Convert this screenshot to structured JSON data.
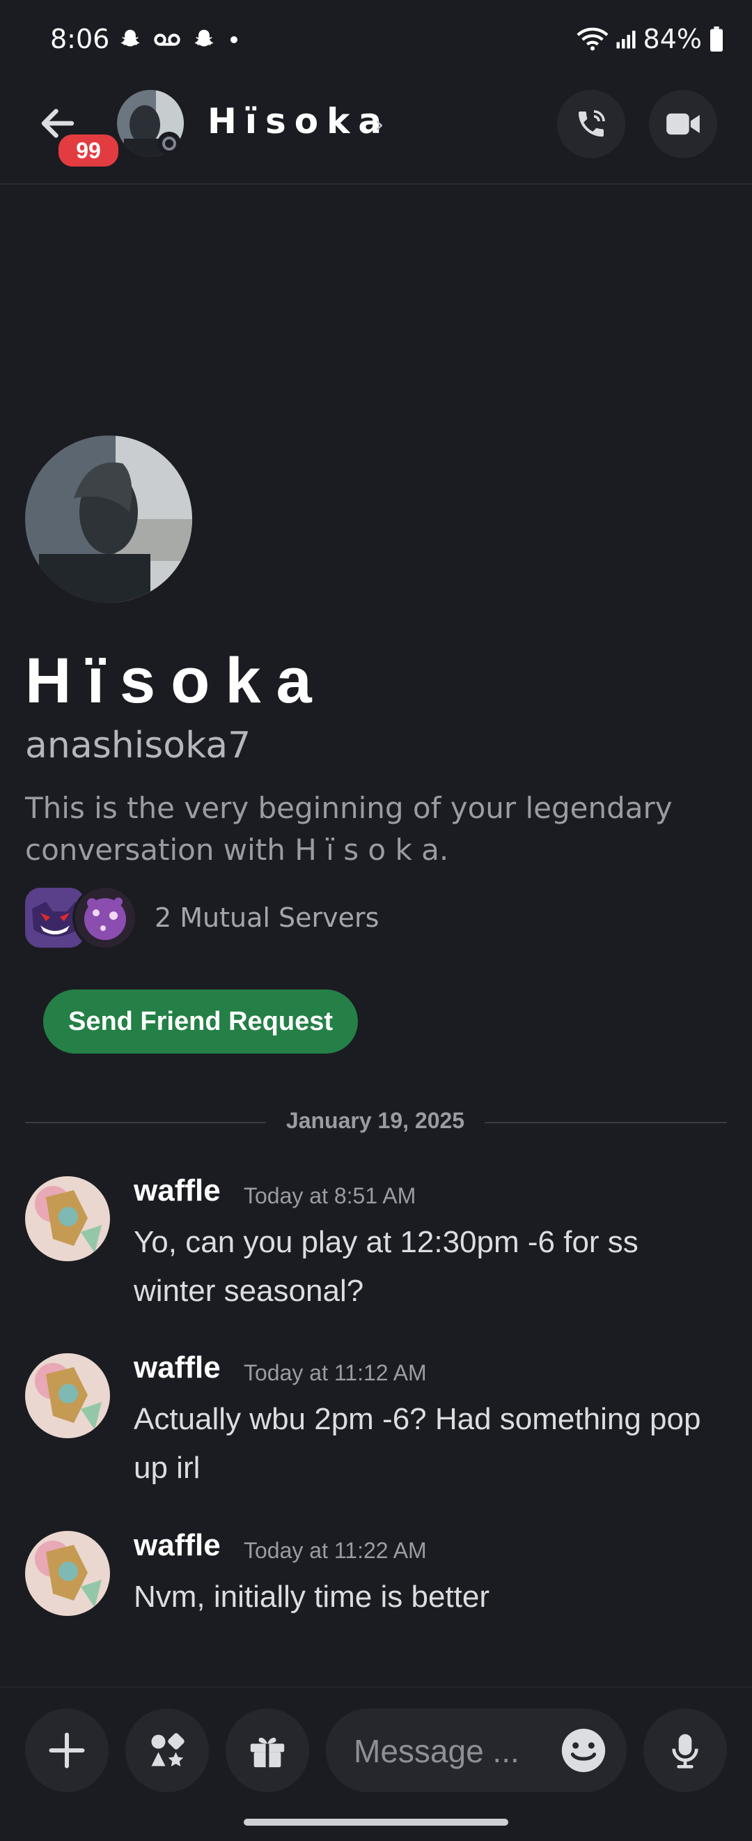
{
  "status_bar": {
    "time": "8:06",
    "battery": "84%",
    "icons": [
      "snapchat-icon",
      "voicemail-icon",
      "snapchat-icon",
      "dot-icon",
      "wifi-icon",
      "signal-icon",
      "battery-icon"
    ]
  },
  "header": {
    "name": "Hïsoka",
    "chevron": "›",
    "badge": "99"
  },
  "profile": {
    "display_name": "Hïsoka",
    "username": "anashisoka7",
    "intro": "This is the very beginning of your legendary conversation with H ï s o k a.",
    "mutual_servers": "2 Mutual Servers",
    "friend_button": "Send Friend Request"
  },
  "divider_date": "January 19, 2025",
  "messages": [
    {
      "author": "waffle",
      "time": "Today at 8:51 AM",
      "text": "Yo, can you play at 12:30pm -6 for ss winter seasonal?"
    },
    {
      "author": "waffle",
      "time": "Today at 11:12 AM",
      "text": "Actually wbu 2pm -6? Had something pop up irl"
    },
    {
      "author": "waffle",
      "time": "Today at 11:22 AM",
      "text": "Nvm, initially time is better"
    }
  ],
  "composer": {
    "placeholder": "Message ..."
  },
  "colors": {
    "background": "#1b1c21",
    "accent_green": "#248046",
    "badge_red": "#e23c41"
  }
}
